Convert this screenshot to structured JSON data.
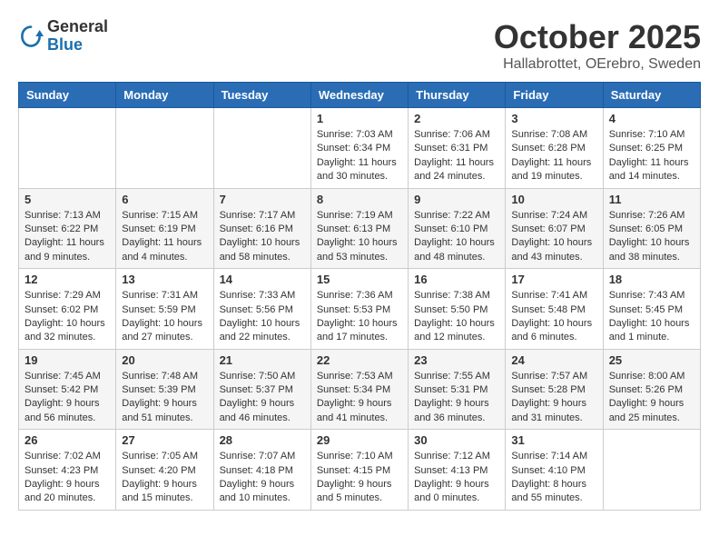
{
  "header": {
    "logo_general": "General",
    "logo_blue": "Blue",
    "month": "October 2025",
    "location": "Hallabrottet, OErebro, Sweden"
  },
  "weekdays": [
    "Sunday",
    "Monday",
    "Tuesday",
    "Wednesday",
    "Thursday",
    "Friday",
    "Saturday"
  ],
  "weeks": [
    [
      {
        "day": "",
        "info": ""
      },
      {
        "day": "",
        "info": ""
      },
      {
        "day": "",
        "info": ""
      },
      {
        "day": "1",
        "info": "Sunrise: 7:03 AM\nSunset: 6:34 PM\nDaylight: 11 hours\nand 30 minutes."
      },
      {
        "day": "2",
        "info": "Sunrise: 7:06 AM\nSunset: 6:31 PM\nDaylight: 11 hours\nand 24 minutes."
      },
      {
        "day": "3",
        "info": "Sunrise: 7:08 AM\nSunset: 6:28 PM\nDaylight: 11 hours\nand 19 minutes."
      },
      {
        "day": "4",
        "info": "Sunrise: 7:10 AM\nSunset: 6:25 PM\nDaylight: 11 hours\nand 14 minutes."
      }
    ],
    [
      {
        "day": "5",
        "info": "Sunrise: 7:13 AM\nSunset: 6:22 PM\nDaylight: 11 hours\nand 9 minutes."
      },
      {
        "day": "6",
        "info": "Sunrise: 7:15 AM\nSunset: 6:19 PM\nDaylight: 11 hours\nand 4 minutes."
      },
      {
        "day": "7",
        "info": "Sunrise: 7:17 AM\nSunset: 6:16 PM\nDaylight: 10 hours\nand 58 minutes."
      },
      {
        "day": "8",
        "info": "Sunrise: 7:19 AM\nSunset: 6:13 PM\nDaylight: 10 hours\nand 53 minutes."
      },
      {
        "day": "9",
        "info": "Sunrise: 7:22 AM\nSunset: 6:10 PM\nDaylight: 10 hours\nand 48 minutes."
      },
      {
        "day": "10",
        "info": "Sunrise: 7:24 AM\nSunset: 6:07 PM\nDaylight: 10 hours\nand 43 minutes."
      },
      {
        "day": "11",
        "info": "Sunrise: 7:26 AM\nSunset: 6:05 PM\nDaylight: 10 hours\nand 38 minutes."
      }
    ],
    [
      {
        "day": "12",
        "info": "Sunrise: 7:29 AM\nSunset: 6:02 PM\nDaylight: 10 hours\nand 32 minutes."
      },
      {
        "day": "13",
        "info": "Sunrise: 7:31 AM\nSunset: 5:59 PM\nDaylight: 10 hours\nand 27 minutes."
      },
      {
        "day": "14",
        "info": "Sunrise: 7:33 AM\nSunset: 5:56 PM\nDaylight: 10 hours\nand 22 minutes."
      },
      {
        "day": "15",
        "info": "Sunrise: 7:36 AM\nSunset: 5:53 PM\nDaylight: 10 hours\nand 17 minutes."
      },
      {
        "day": "16",
        "info": "Sunrise: 7:38 AM\nSunset: 5:50 PM\nDaylight: 10 hours\nand 12 minutes."
      },
      {
        "day": "17",
        "info": "Sunrise: 7:41 AM\nSunset: 5:48 PM\nDaylight: 10 hours\nand 6 minutes."
      },
      {
        "day": "18",
        "info": "Sunrise: 7:43 AM\nSunset: 5:45 PM\nDaylight: 10 hours\nand 1 minute."
      }
    ],
    [
      {
        "day": "19",
        "info": "Sunrise: 7:45 AM\nSunset: 5:42 PM\nDaylight: 9 hours\nand 56 minutes."
      },
      {
        "day": "20",
        "info": "Sunrise: 7:48 AM\nSunset: 5:39 PM\nDaylight: 9 hours\nand 51 minutes."
      },
      {
        "day": "21",
        "info": "Sunrise: 7:50 AM\nSunset: 5:37 PM\nDaylight: 9 hours\nand 46 minutes."
      },
      {
        "day": "22",
        "info": "Sunrise: 7:53 AM\nSunset: 5:34 PM\nDaylight: 9 hours\nand 41 minutes."
      },
      {
        "day": "23",
        "info": "Sunrise: 7:55 AM\nSunset: 5:31 PM\nDaylight: 9 hours\nand 36 minutes."
      },
      {
        "day": "24",
        "info": "Sunrise: 7:57 AM\nSunset: 5:28 PM\nDaylight: 9 hours\nand 31 minutes."
      },
      {
        "day": "25",
        "info": "Sunrise: 8:00 AM\nSunset: 5:26 PM\nDaylight: 9 hours\nand 25 minutes."
      }
    ],
    [
      {
        "day": "26",
        "info": "Sunrise: 7:02 AM\nSunset: 4:23 PM\nDaylight: 9 hours\nand 20 minutes."
      },
      {
        "day": "27",
        "info": "Sunrise: 7:05 AM\nSunset: 4:20 PM\nDaylight: 9 hours\nand 15 minutes."
      },
      {
        "day": "28",
        "info": "Sunrise: 7:07 AM\nSunset: 4:18 PM\nDaylight: 9 hours\nand 10 minutes."
      },
      {
        "day": "29",
        "info": "Sunrise: 7:10 AM\nSunset: 4:15 PM\nDaylight: 9 hours\nand 5 minutes."
      },
      {
        "day": "30",
        "info": "Sunrise: 7:12 AM\nSunset: 4:13 PM\nDaylight: 9 hours\nand 0 minutes."
      },
      {
        "day": "31",
        "info": "Sunrise: 7:14 AM\nSunset: 4:10 PM\nDaylight: 8 hours\nand 55 minutes."
      },
      {
        "day": "",
        "info": ""
      }
    ]
  ]
}
